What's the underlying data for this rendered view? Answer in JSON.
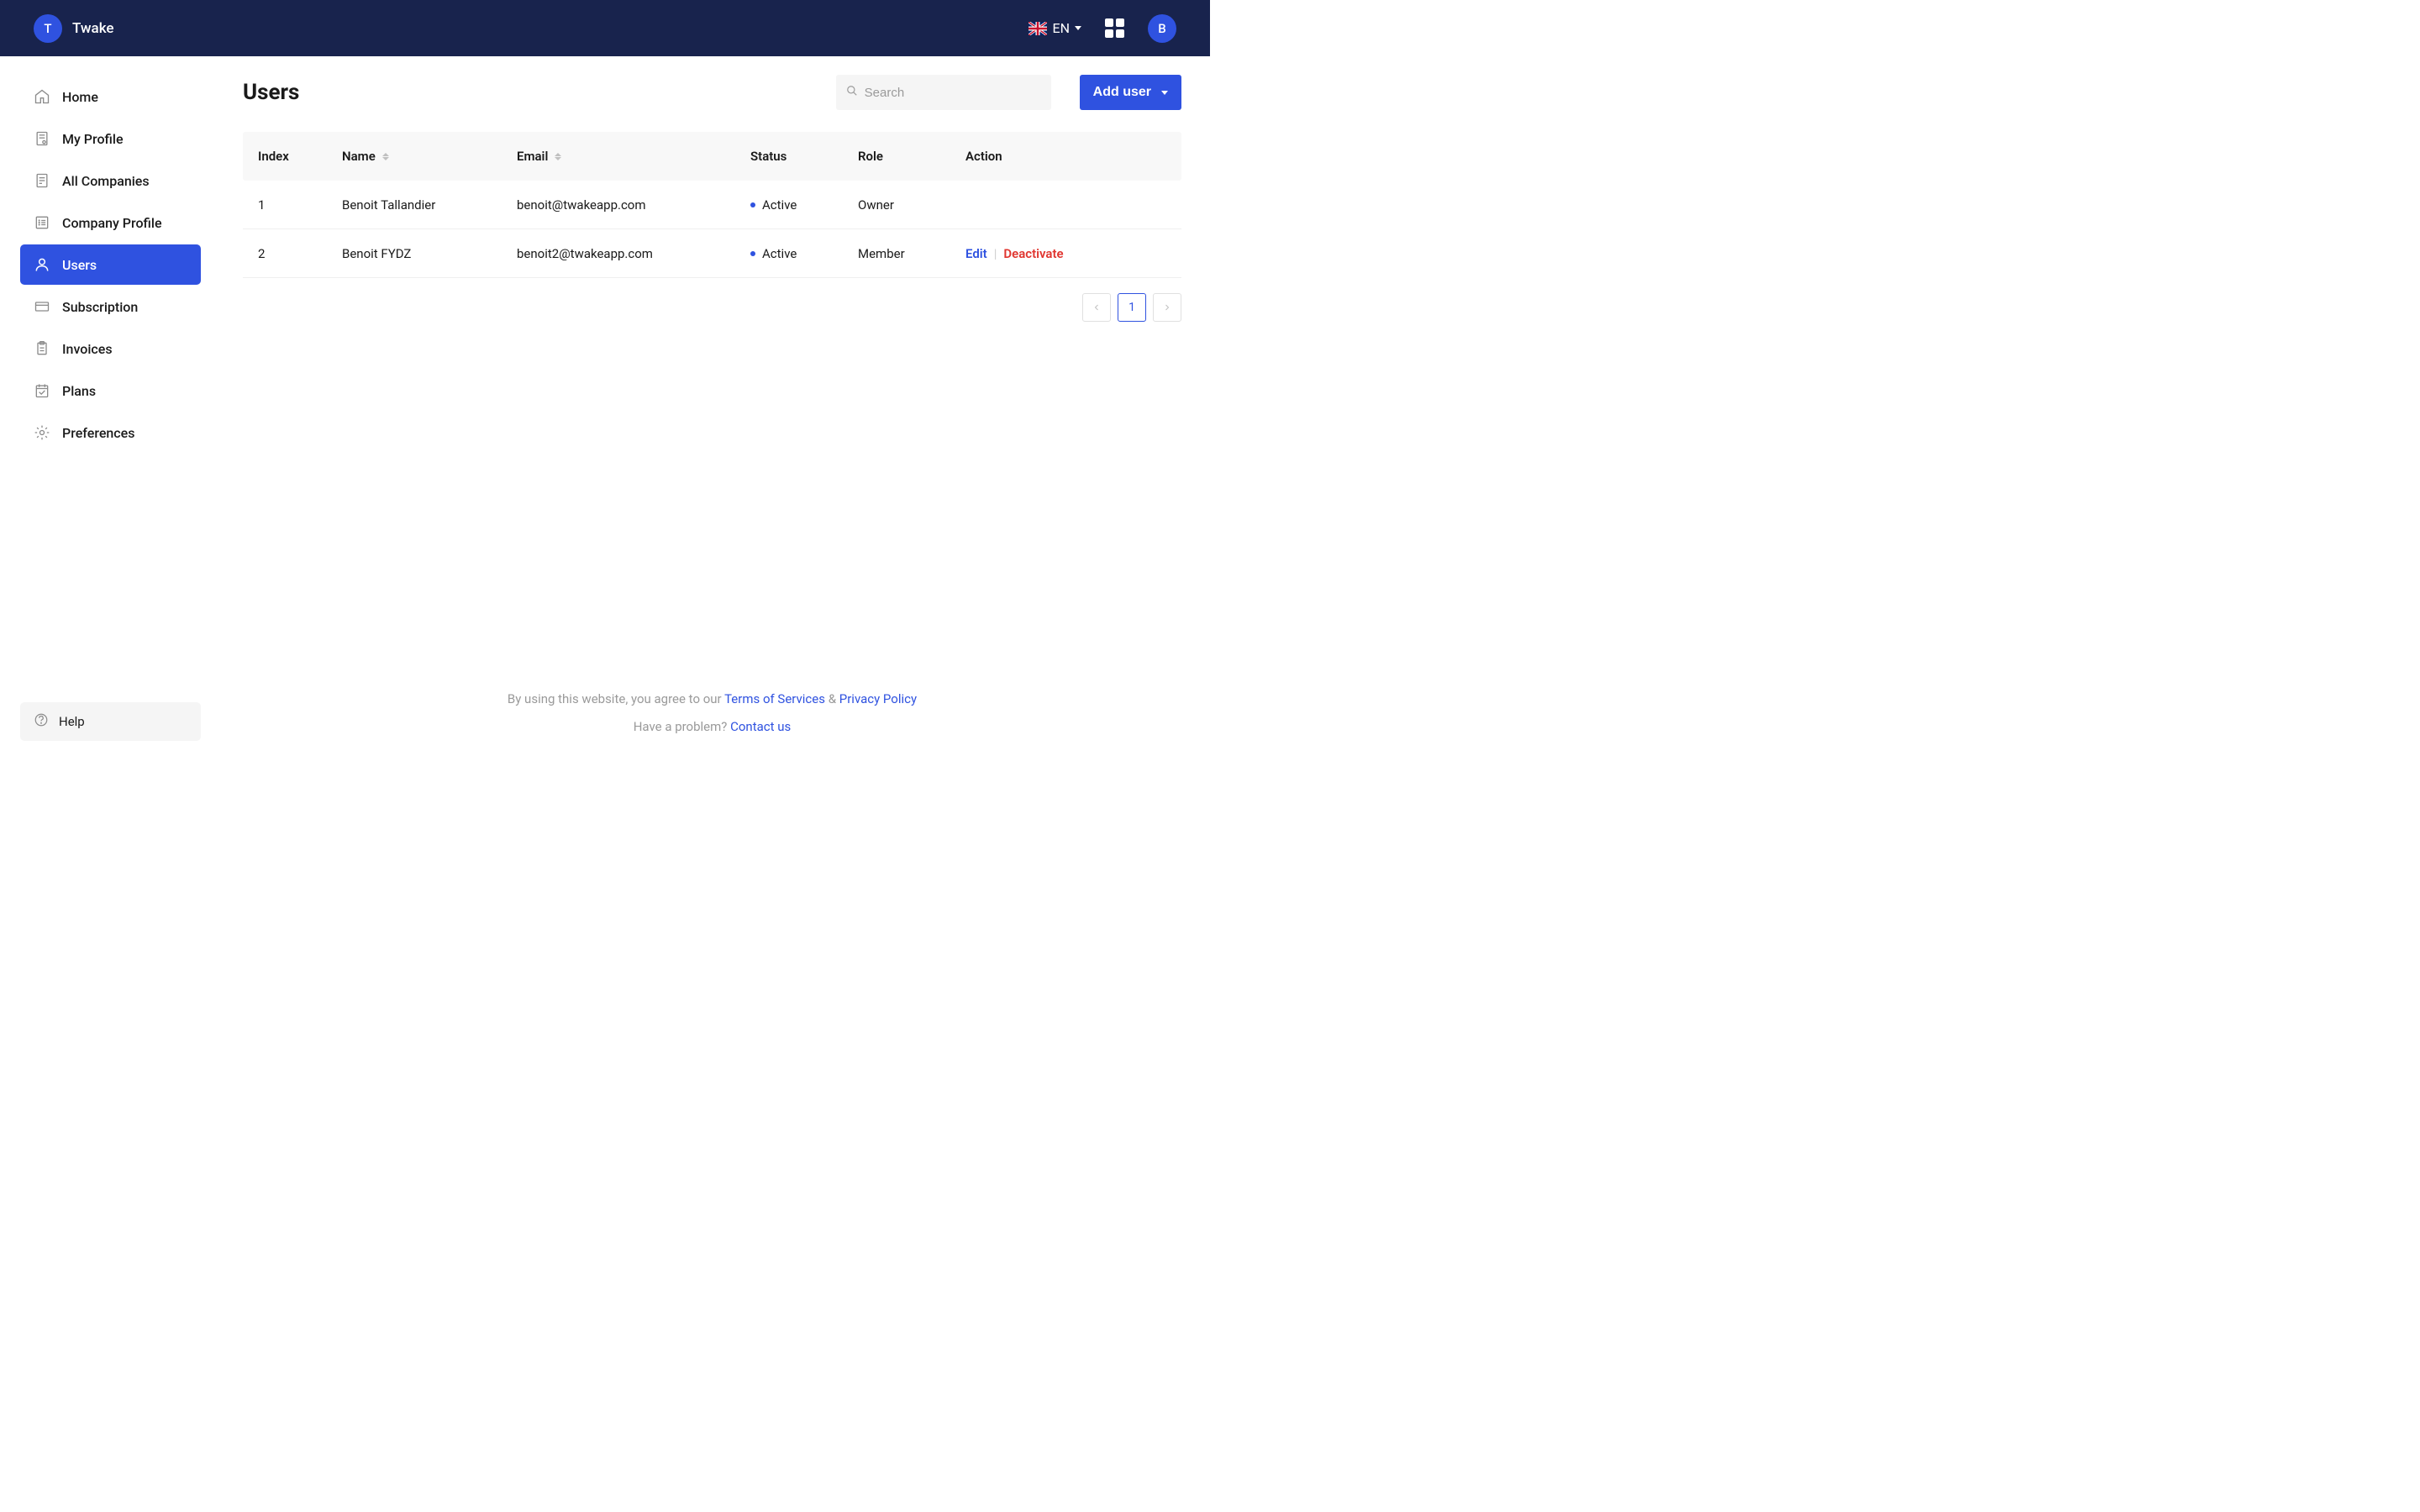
{
  "header": {
    "app_initial": "T",
    "app_name": "Twake",
    "language": "EN",
    "user_initial": "B"
  },
  "sidebar": {
    "items": [
      {
        "label": "Home"
      },
      {
        "label": "My Profile"
      },
      {
        "label": "All Companies"
      },
      {
        "label": "Company Profile"
      },
      {
        "label": "Users"
      },
      {
        "label": "Subscription"
      },
      {
        "label": "Invoices"
      },
      {
        "label": "Plans"
      },
      {
        "label": "Preferences"
      }
    ],
    "help_label": "Help"
  },
  "page": {
    "title": "Users",
    "search_placeholder": "Search",
    "add_user_label": "Add user"
  },
  "table": {
    "columns": {
      "index": "Index",
      "name": "Name",
      "email": "Email",
      "status": "Status",
      "role": "Role",
      "action": "Action"
    },
    "rows": [
      {
        "index": "1",
        "name": "Benoit Tallandier",
        "email": "benoit@twakeapp.com",
        "status": "Active",
        "role": "Owner",
        "has_actions": false
      },
      {
        "index": "2",
        "name": "Benoit FYDZ",
        "email": "benoit2@twakeapp.com",
        "status": "Active",
        "role": "Member",
        "has_actions": true
      }
    ],
    "actions": {
      "edit": "Edit",
      "deactivate": "Deactivate"
    }
  },
  "pagination": {
    "current": "1"
  },
  "footer": {
    "prefix": "By using this website, you agree to our ",
    "terms": "Terms of Services",
    "amp": " & ",
    "privacy": "Privacy Policy",
    "problem_prefix": "Have a problem? ",
    "contact": "Contact us"
  }
}
